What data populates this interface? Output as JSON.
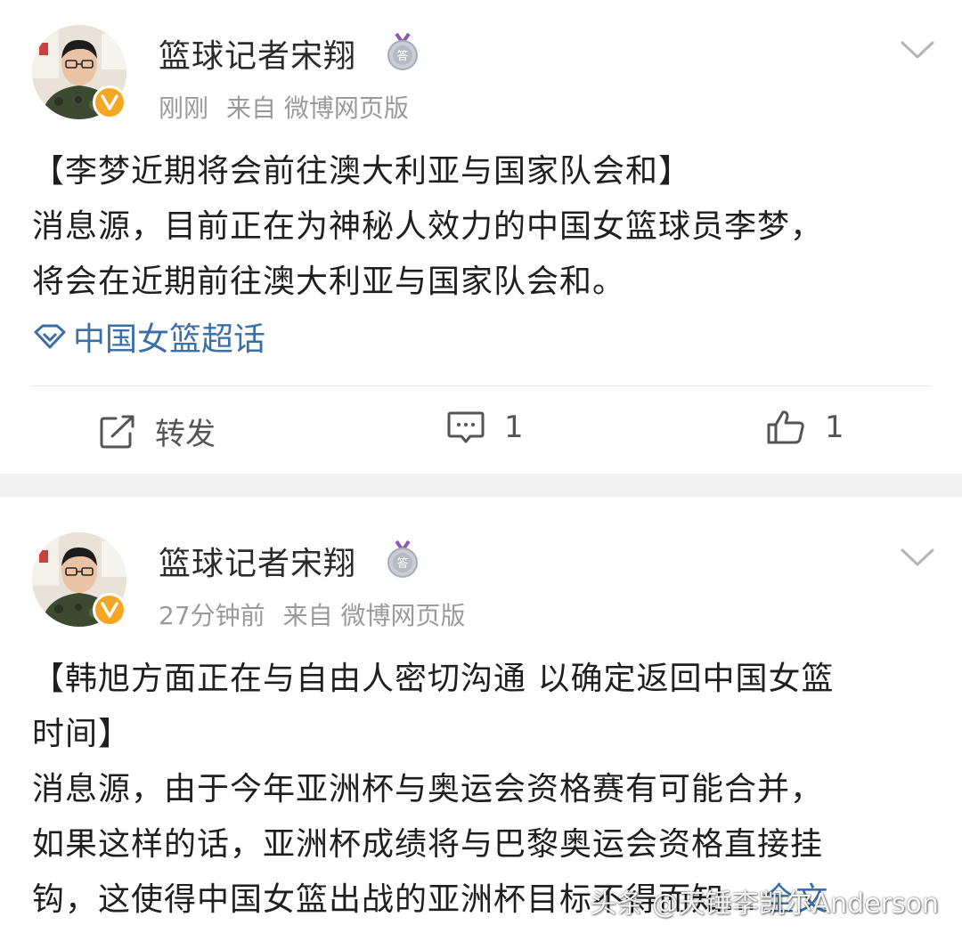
{
  "posts": [
    {
      "username": "篮球记者宋翔",
      "time": "刚刚",
      "source": "来自 微博网页版",
      "title": "【李梦近期将会前往澳大利亚与国家队会和】",
      "body_lines": [
        "消息源，目前正在为神秘人效力的中国女篮球员李梦，",
        "将会在近期前往澳大利亚与国家队会和。"
      ],
      "topic": "中国女篮超话",
      "actions": {
        "repost_label": "转发",
        "comment_count": "1",
        "like_count": "1"
      }
    },
    {
      "username": "篮球记者宋翔",
      "time": "27分钟前",
      "source": "来自 微博网页版",
      "title_lines": [
        "【韩旭方面正在与自由人密切沟通 以确定返回中国女篮",
        "时间】"
      ],
      "body_lines": [
        "消息源，由于今年亚洲杯与奥运会资格赛有可能合并，",
        "如果这样的话，亚洲杯成绩将与巴黎奥运会资格直接挂",
        "钩，这使得中国女篮出战的亚洲杯目标不得而知..."
      ],
      "more_label": "全文"
    }
  ],
  "watermark": "头条 @天锤李凯尔Anderson",
  "colors": {
    "topic_blue": "#3a6fa8",
    "verified_badge": "#f5a623",
    "meta_gray": "#9a9a9a",
    "separator": "#f2f2f2"
  }
}
